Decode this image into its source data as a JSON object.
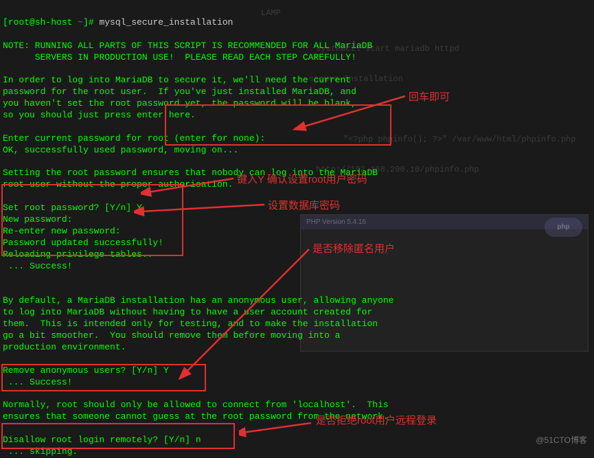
{
  "prompt": {
    "user_host": "[root@sh-host ",
    "path": "~",
    "close": "]# ",
    "command": "mysql_secure_installation"
  },
  "note": "NOTE: RUNNING ALL PARTS OF THIS SCRIPT IS RECOMMENDED FOR ALL MariaDB\n      SERVERS IN PRODUCTION USE!  PLEASE READ EACH STEP CAREFULLY!",
  "intro": "In order to log into MariaDB to secure it, we'll need the current\npassword for the root user.  If you've just installed MariaDB, and\nyou haven't set the root password yet, the password will be blank,\nso you should just press enter here.",
  "enter_pw": "Enter current password for root (enter for none):\nOK, successfully used password, moving on...",
  "setting_pw": "Setting the root password ensures that nobody can log into the MariaDB\nroot user without the proper authorisation.",
  "set_root": "Set root password? [Y/n] Y\nNew password:\nRe-enter new password:\nPassword updated successfully!\nReloading privilege tables..\n ... Success!",
  "anon": "By default, a MariaDB installation has an anonymous user, allowing anyone\nto log into MariaDB without having to have a user account created for\nthem.  This is intended only for testing, and to make the installation\ngo a bit smoother.  You should remove them before moving into a\nproduction environment.",
  "remove_anon": "Remove anonymous users? [Y/n] Y\n ... Success!",
  "normally": "Normally, root should only be allowed to connect from 'localhost'.  This\nensures that someone cannot guess at the root password from the network.",
  "disallow": "Disallow root login remotely? [Y/n] n\n ... skipping.",
  "annotations": {
    "enter": "回车即可",
    "confirm_root": "键入Y 确认设置root用户密码",
    "set_db_pw": "设置数据库密码",
    "remove_anon_label": "是否移除匿名用户",
    "disallow_label": "是否拒绝root用户远程登录"
  },
  "ghost": {
    "lamp": "LAMP",
    "systemctl": "systemctl start mariadb httpd",
    "secure": "secure_installation",
    "phpecho": "\"<?php phpinfo(); ?>\"  /var/www/html/phpinfo.php",
    "ip": "http://192.168.200.10/phpinfo.php",
    "phpver": "PHP Version 5.4.16"
  },
  "watermark": "@51CTO博客"
}
